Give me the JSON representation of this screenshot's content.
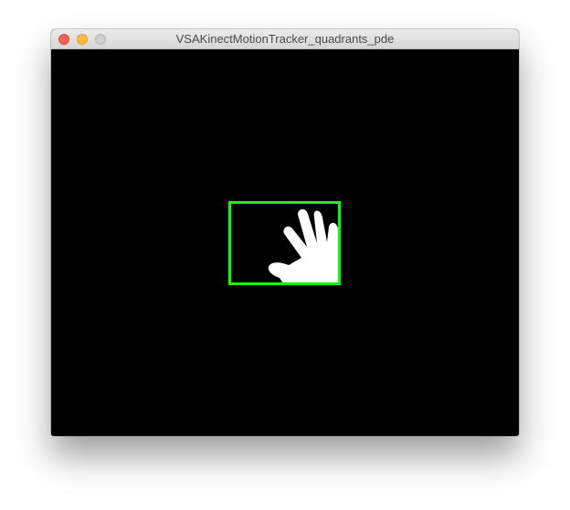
{
  "window": {
    "title": "VSAKinectMotionTracker_quadrants_pde",
    "controls": [
      "close-button",
      "minimize-button",
      "zoom-button"
    ]
  },
  "canvas": {
    "background_color": "#000000",
    "tracker_box_color": "#17f01b",
    "hand_color": "#ffffff"
  }
}
